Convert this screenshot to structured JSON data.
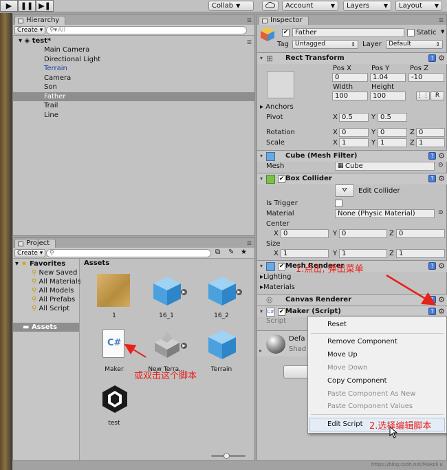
{
  "toolbar": {
    "play_icons": [
      "▶",
      "❚❚",
      "▶❚"
    ],
    "collab_label": "Collab",
    "account_label": "Account",
    "layers_label": "Layers",
    "layout_label": "Layout"
  },
  "hierarchy": {
    "tab_label": "Hierarchy",
    "create_label": "Create",
    "search_placeholder": "All",
    "scene_name": "test*",
    "items": [
      "Main Camera",
      "Directional Light",
      "Terrain",
      "Camera",
      "Son",
      "Father",
      "Trail",
      "Line"
    ],
    "selected_item": "Father",
    "blue_item": "Terrain"
  },
  "project": {
    "tab_label": "Project",
    "create_label": "Create",
    "favorites_label": "Favorites",
    "favorites": [
      "New Saved",
      "All Materials",
      "All Models",
      "All Prefabs",
      "All Script"
    ],
    "assets_root_label": "Assets",
    "assets_header": "Assets",
    "assets": [
      "1",
      "16_1",
      "16_2",
      "Maker",
      "New Terra...",
      "Terrain",
      "test"
    ]
  },
  "inspector": {
    "tab_label": "Inspector",
    "object_name": "Father",
    "static_label": "Static",
    "tag_label": "Tag",
    "tag_value": "Untagged",
    "layer_label": "Layer",
    "layer_value": "Default",
    "rect": {
      "title": "Rect Transform",
      "pos_x_label": "Pos X",
      "pos_y_label": "Pos Y",
      "pos_z_label": "Pos Z",
      "pos_x": "0",
      "pos_y": "1.04",
      "pos_z": "-10",
      "width_label": "Width",
      "height_label": "Height",
      "width": "100",
      "height": "100",
      "r_button": "R",
      "anchors_label": "Anchors",
      "pivot_label": "Pivot",
      "pivot_x": "0.5",
      "pivot_y": "0.5",
      "rotation_label": "Rotation",
      "rot_x": "0",
      "rot_y": "0",
      "rot_z": "0",
      "scale_label": "Scale",
      "scale_x": "1",
      "scale_y": "1",
      "scale_z": "1",
      "x": "X",
      "y": "Y",
      "z": "Z"
    },
    "mesh_filter": {
      "title": "Cube (Mesh Filter)",
      "mesh_label": "Mesh",
      "mesh_value": "Cube"
    },
    "box_collider": {
      "title": "Box Collider",
      "edit_collider_label": "Edit Collider",
      "is_trigger_label": "Is Trigger",
      "material_label": "Material",
      "material_value": "None (Physic Material)",
      "center_label": "Center",
      "center_x": "0",
      "center_y": "0",
      "center_z": "0",
      "size_label": "Size",
      "size_x": "1",
      "size_y": "1",
      "size_z": "1"
    },
    "mesh_renderer": {
      "title": "Mesh Renderer",
      "lighting_label": "Lighting",
      "materials_label": "Materials"
    },
    "canvas_renderer": {
      "title": "Canvas Renderer"
    },
    "maker_script": {
      "title": "Maker (Script)",
      "script_label": "Script"
    },
    "material_preview": {
      "name": "Defa",
      "shader": "Shad"
    }
  },
  "context_menu": {
    "items": [
      {
        "label": "Reset",
        "disabled": false
      },
      {
        "label": "Remove Component",
        "disabled": false
      },
      {
        "label": "Move Up",
        "disabled": false
      },
      {
        "label": "Move Down",
        "disabled": true
      },
      {
        "label": "Copy Component",
        "disabled": false
      },
      {
        "label": "Paste Component As New",
        "disabled": true
      },
      {
        "label": "Paste Component Values",
        "disabled": true
      },
      {
        "label": "Edit Script",
        "disabled": false
      }
    ]
  },
  "annotations": {
    "note1": "1.点击, 弹出菜单",
    "note2": "2.选择编辑脚本",
    "note3": "或双击这个脚本",
    "watermark": "https://blog.csdn.net/Makeli u"
  },
  "colors": {
    "annotation_red": "#e8211a",
    "selection_bg": "#8e8e8e",
    "terrain_blue": "#1f3fa1",
    "help_blue": "#4b7bd6"
  }
}
